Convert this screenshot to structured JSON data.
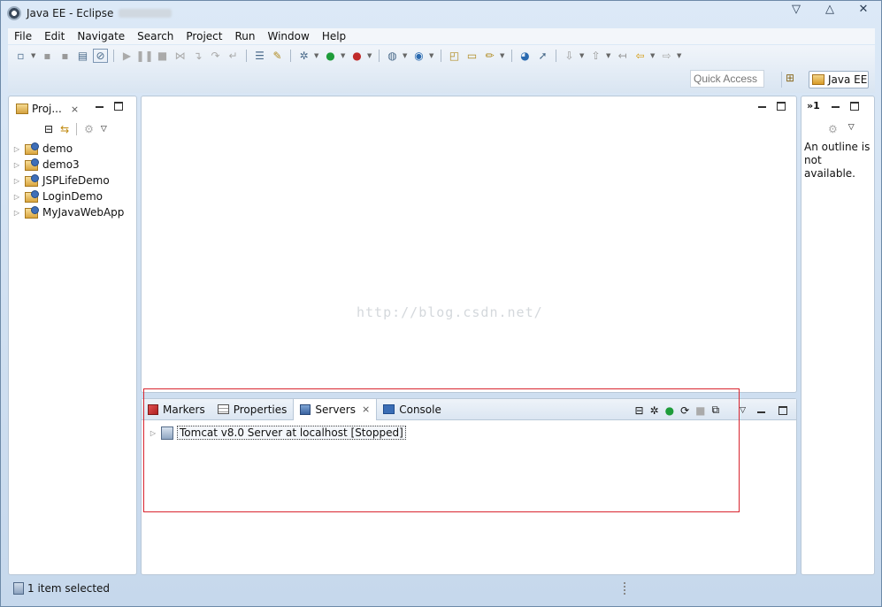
{
  "window": {
    "title": "Java EE - Eclipse",
    "controls": [
      "▽",
      "△",
      "✕"
    ]
  },
  "menu": [
    "File",
    "Edit",
    "Navigate",
    "Search",
    "Project",
    "Run",
    "Window",
    "Help"
  ],
  "toolbar": {
    "quick_access_placeholder": "Quick Access",
    "perspective_label": "Java EE"
  },
  "project_explorer": {
    "tab_label": "Proj...",
    "projects": [
      "demo",
      "demo3",
      "JSPLifeDemo",
      "LoginDemo",
      "MyJavaWebApp"
    ]
  },
  "editor": {
    "watermark": "http://blog.csdn.net/"
  },
  "bottom_panel": {
    "tabs": [
      {
        "label": "Markers"
      },
      {
        "label": "Properties"
      },
      {
        "label": "Servers"
      },
      {
        "label": "Console"
      }
    ],
    "active_tab": "Servers",
    "server": "Tomcat v8.0 Server at localhost  [Stopped]"
  },
  "outline": {
    "tab_label": "»1",
    "message": "An outline is not available."
  },
  "status": {
    "text": "1 item selected"
  },
  "colors": {
    "highlight_box": "#d9252f",
    "chrome": "#c6d8ec"
  }
}
